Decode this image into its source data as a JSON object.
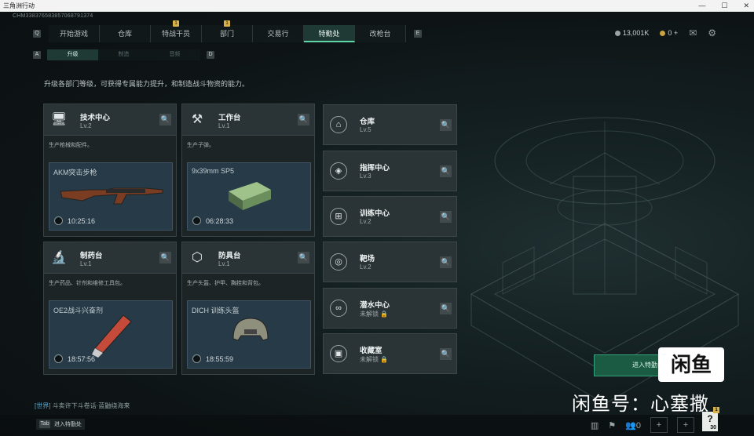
{
  "window": {
    "title": "三角洲行动",
    "buttons": [
      "—",
      "☐",
      "✕"
    ]
  },
  "session_id": "CHM3383765838570687913​74",
  "nav": {
    "left_key": "Q",
    "right_key": "E",
    "tabs": [
      {
        "label": "开始游戏",
        "badge": ""
      },
      {
        "label": "仓库",
        "badge": ""
      },
      {
        "label": "特战干员",
        "badge": "1"
      },
      {
        "label": "部门",
        "badge": "1"
      },
      {
        "label": "交易行",
        "badge": ""
      },
      {
        "label": "特勤处",
        "badge": "",
        "active": true
      },
      {
        "label": "改枪台",
        "badge": ""
      }
    ]
  },
  "currency": {
    "silver": "13,001K",
    "gold": "0 +"
  },
  "subnav": {
    "left_key": "A",
    "right_key": "D",
    "tabs": [
      {
        "label": "升级",
        "active": true
      },
      {
        "label": "制造",
        "active": false
      },
      {
        "label": "音频",
        "active": false
      }
    ]
  },
  "description": "升级各部门等级，可获得专属能力提升，和制造战斗物资的能力。",
  "facilities": [
    {
      "name": "技术中心",
      "level": "Lv.2",
      "sub": "生产枪械和配件。",
      "item": "AKM突击步枪",
      "timer": "10:25:16"
    },
    {
      "name": "工作台",
      "level": "Lv.1",
      "sub": "生产子弹。",
      "item": "9x39mm SP5",
      "timer": "06:28:33"
    },
    {
      "name": "制药台",
      "level": "Lv.1",
      "sub": "生产药品、针剂和维修工具包。",
      "item": "OE2战斗兴奋剂",
      "timer": "18:57:56"
    },
    {
      "name": "防具台",
      "level": "Lv.1",
      "sub": "生产头盔、护甲、胸挂和背包。",
      "item": "DICH 训练头盔",
      "timer": "18:55:59"
    }
  ],
  "rooms": [
    {
      "name": "仓库",
      "level": "Lv.5"
    },
    {
      "name": "指挥中心",
      "level": "Lv.3"
    },
    {
      "name": "训练中心",
      "level": "Lv.2"
    },
    {
      "name": "靶场",
      "level": "Lv.2"
    },
    {
      "name": "潜水中心",
      "level": "未解锁 🔒"
    },
    {
      "name": "收藏室",
      "level": "未解锁 🔒"
    }
  ],
  "chat": {
    "channel": "[世界]",
    "text": "斗卖许下斗卷话·蓝鼬绕海来"
  },
  "bottom": {
    "key": "Tab",
    "label": "进入特勤处",
    "help_count": "30",
    "help_badge": "1",
    "friends": "0"
  },
  "enter_button": "进入特勤",
  "watermark": {
    "logo": "闲鱼",
    "text": "闲鱼号：心塞撒"
  }
}
